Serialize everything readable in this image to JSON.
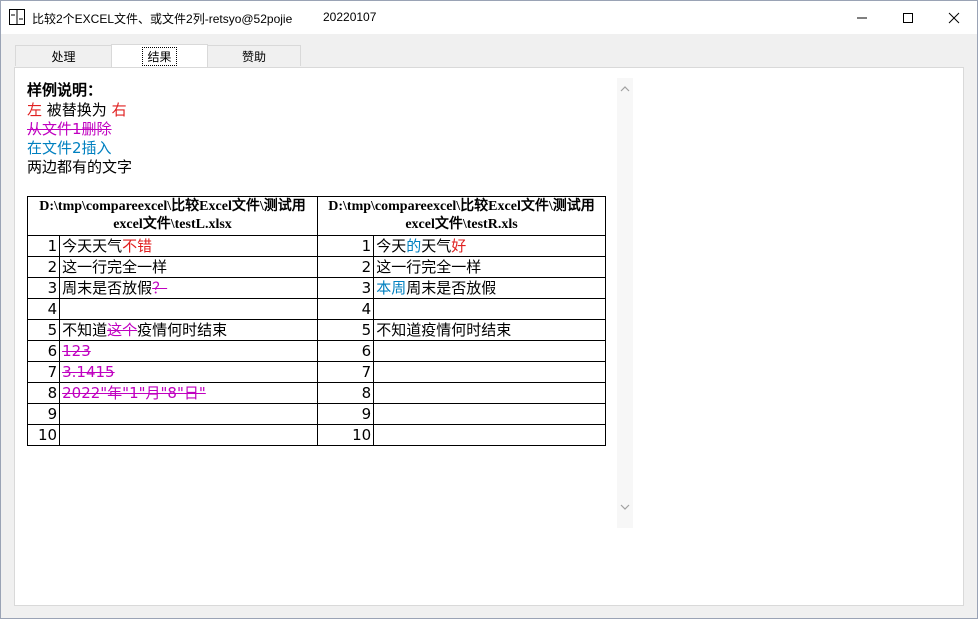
{
  "window": {
    "title": "比较2个EXCEL文件、或文件2列-retsyo@52pojie",
    "date": "20220107"
  },
  "icons": {
    "app": "compare-icon",
    "minimize": "minimize-icon",
    "maximize": "maximize-icon",
    "close": "close-icon",
    "scroll_up": "chevron-up-icon",
    "scroll_down": "chevron-down-icon"
  },
  "tabs": [
    {
      "label": "处理",
      "active": false
    },
    {
      "label": "结果",
      "active": true
    },
    {
      "label": "赞助",
      "active": false
    }
  ],
  "legend": {
    "title": "样例说明：",
    "replace_left": "左",
    "replace_mid": " 被替换为 ",
    "replace_right": "右",
    "deleted": "从文件1删除",
    "inserted": "在文件2插入",
    "common": "两边都有的文字"
  },
  "colors": {
    "replace": "#e02020",
    "deleted": "#c000c0",
    "inserted": "#0080c0"
  },
  "table": {
    "left_header": "D:\\tmp\\compareexcel\\比较Excel文件\\测试用excel文件\\testL.xlsx",
    "right_header": "D:\\tmp\\compareexcel\\比较Excel文件\\测试用excel文件\\testR.xls",
    "rows": [
      {
        "n": "1",
        "left": [
          {
            "t": "今天天气",
            "s": "plain"
          },
          {
            "t": "不错",
            "s": "replace"
          }
        ],
        "right": [
          {
            "t": "今天",
            "s": "plain"
          },
          {
            "t": "的",
            "s": "insert"
          },
          {
            "t": "天气",
            "s": "plain"
          },
          {
            "t": "好",
            "s": "replace"
          }
        ]
      },
      {
        "n": "2",
        "left": [
          {
            "t": "这一行完全一样",
            "s": "plain"
          }
        ],
        "right": [
          {
            "t": "这一行完全一样",
            "s": "plain"
          }
        ]
      },
      {
        "n": "3",
        "left": [
          {
            "t": "周末是否放假",
            "s": "plain"
          },
          {
            "t": "？",
            "s": "delete"
          }
        ],
        "right": [
          {
            "t": "本周",
            "s": "insert"
          },
          {
            "t": "周末是否放假",
            "s": "plain"
          }
        ]
      },
      {
        "n": "4",
        "left": [],
        "right": []
      },
      {
        "n": "5",
        "left": [
          {
            "t": "不知道",
            "s": "plain"
          },
          {
            "t": "这个",
            "s": "delete"
          },
          {
            "t": "疫情何时结束",
            "s": "plain"
          }
        ],
        "right": [
          {
            "t": "不知道疫情何时结束",
            "s": "plain"
          }
        ]
      },
      {
        "n": "6",
        "left": [
          {
            "t": "123",
            "s": "delete"
          }
        ],
        "right": []
      },
      {
        "n": "7",
        "left": [
          {
            "t": "3.1415",
            "s": "delete"
          }
        ],
        "right": []
      },
      {
        "n": "8",
        "left": [
          {
            "t": "2022\"年\"1\"月\"8\"日\"",
            "s": "delete"
          }
        ],
        "right": []
      },
      {
        "n": "9",
        "left": [],
        "right": []
      },
      {
        "n": "10",
        "left": [],
        "right": []
      }
    ]
  }
}
